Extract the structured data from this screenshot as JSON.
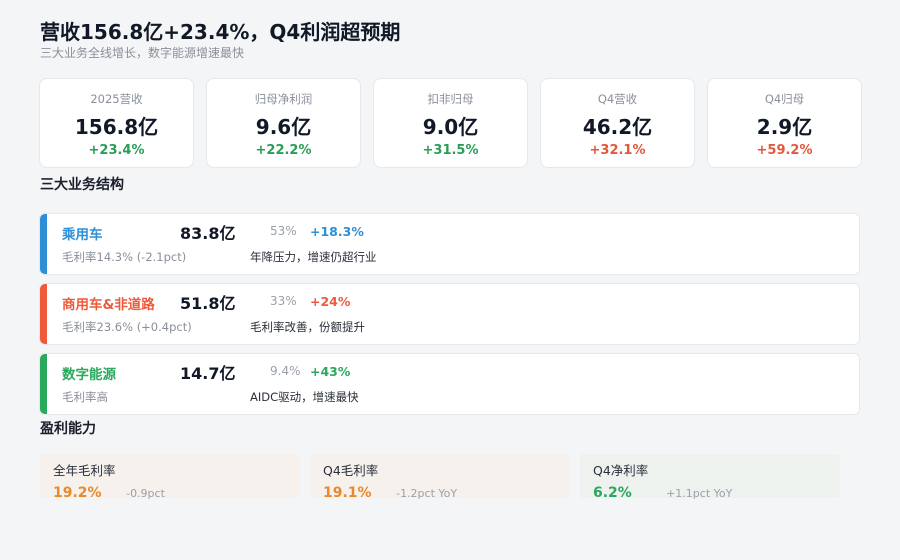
{
  "header": {
    "title": "营收156.8亿+23.4%，Q4利润超预期",
    "subtitle": "三大业务全线增长，数字能源增速最快"
  },
  "kpis": [
    {
      "label": "2025营收",
      "value": "156.8亿",
      "change": "+23.4%"
    },
    {
      "label": "归母净利润",
      "value": "9.6亿",
      "change": "+22.2%"
    },
    {
      "label": "扣非归母",
      "value": "9.0亿",
      "change": "+31.5%"
    },
    {
      "label": "Q4营收",
      "value": "46.2亿",
      "change": "+32.1%"
    },
    {
      "label": "Q4归母",
      "value": "2.9亿",
      "change": "+59.2%"
    }
  ],
  "business_section": {
    "title": "三大业务结构"
  },
  "businesses": [
    {
      "name": "乘用车",
      "revenue": "83.8亿",
      "share": "53%",
      "growth": "+18.3%",
      "margin": "毛利率14.3% (-2.1pct)",
      "note": "年降压力，增速仍超行业",
      "color": "#2f8fd6"
    },
    {
      "name": "商用车&非道路",
      "revenue": "51.8亿",
      "share": "33%",
      "growth": "+24%",
      "margin": "毛利率23.6% (+0.4pct)",
      "note": "毛利率改善，份额提升",
      "color": "#ef5a3c"
    },
    {
      "name": "数字能源",
      "revenue": "14.7亿",
      "share": "9.4%",
      "growth": "+43%",
      "margin": "毛利率高",
      "note": "AIDC驱动，增速最快",
      "color": "#2aa85c"
    }
  ],
  "profit_section": {
    "title": "盈利能力"
  },
  "profitability": [
    {
      "label": "全年毛利率",
      "value": "19.2%",
      "delta": "-0.9pct",
      "color": "#e8892b"
    },
    {
      "label": "Q4毛利率",
      "value": "19.1%",
      "delta": "-1.2pct YoY",
      "color": "#e8892b"
    },
    {
      "label": "Q4净利率",
      "value": "6.2%",
      "delta": "+1.1pct YoY",
      "color": "#2aa85c"
    }
  ]
}
